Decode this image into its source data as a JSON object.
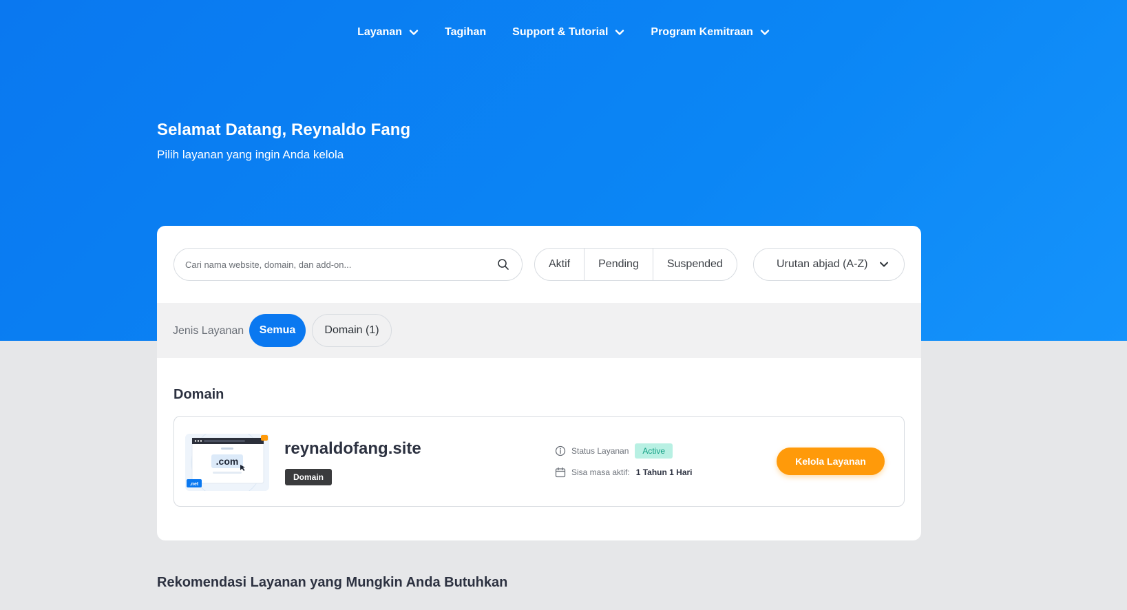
{
  "nav": {
    "items": [
      {
        "label": "Layanan",
        "dropdown": true
      },
      {
        "label": "Tagihan",
        "dropdown": false
      },
      {
        "label": "Support & Tutorial",
        "dropdown": true
      },
      {
        "label": "Program Kemitraan",
        "dropdown": true
      }
    ]
  },
  "welcome": {
    "title": "Selamat Datang, Reynaldo Fang",
    "subtitle": "Pilih layanan yang ingin Anda kelola"
  },
  "toolbar": {
    "search_placeholder": "Cari nama website, domain, dan add-on...",
    "filters": [
      "Aktif",
      "Pending",
      "Suspended"
    ],
    "sort_label": "Urutan abjad (A-Z)"
  },
  "type_filter": {
    "label": "Jenis Layanan",
    "options": [
      {
        "label": "Semua",
        "active": true
      },
      {
        "label": "Domain (1)",
        "active": false
      }
    ]
  },
  "section": {
    "title": "Domain"
  },
  "service": {
    "name": "reynaldofang.site",
    "badge": "Domain",
    "thumb_text": ".com",
    "thumb_tag": ".net",
    "status_label": "Status Layanan",
    "status_value": "Active",
    "remaining_label": "Sisa masa aktif:",
    "remaining_value": "1 Tahun 1 Hari",
    "action_label": "Kelola Layanan"
  },
  "recommendation": {
    "title": "Rekomendasi Layanan yang Mungkin Anda Butuhkan"
  },
  "colors": {
    "primary": "#0a78f0",
    "action": "#ff9a0a",
    "status_bg": "#b8f0e3",
    "status_text": "#12a084"
  }
}
